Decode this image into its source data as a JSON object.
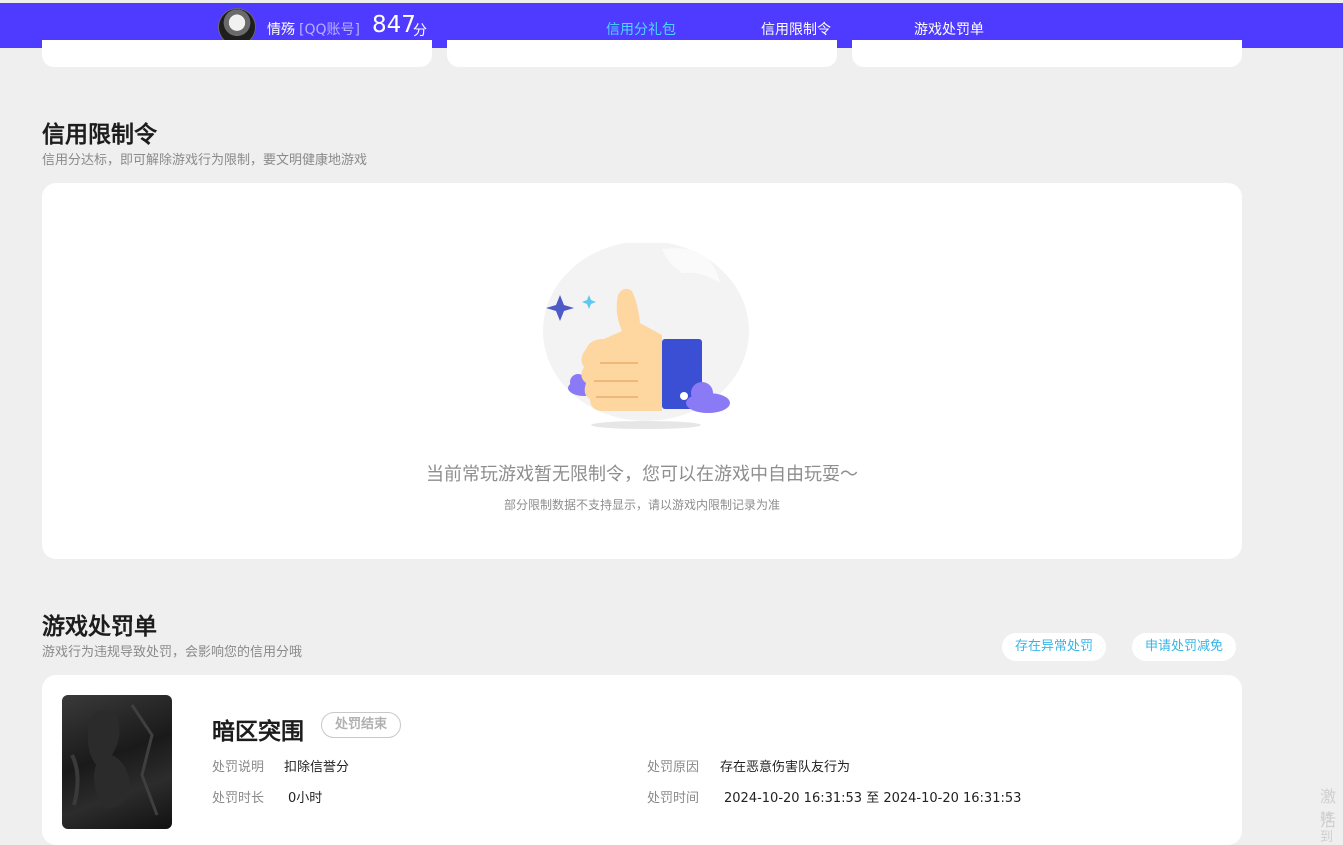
{
  "header": {
    "username": "情殇",
    "account_tag": "[QQ账号]",
    "score": "847",
    "score_unit": "分",
    "tabs": [
      {
        "label": "信用分礼包",
        "active": true
      },
      {
        "label": "信用限制令",
        "active": false
      },
      {
        "label": "游戏处罚单",
        "active": false
      }
    ]
  },
  "restriction": {
    "title": "信用限制令",
    "subtitle": "信用分达标，即可解除游戏行为限制，要文明健康地游戏",
    "empty_message": "当前常玩游戏暂无限制令，您可以在游戏中自由玩耍～",
    "empty_note": "部分限制数据不支持显示，请以游戏内限制记录为准"
  },
  "penalty": {
    "title": "游戏处罚单",
    "subtitle": "游戏行为违规导致处罚，会影响您的信用分哦",
    "btn_abnormal": "存在异常处罚",
    "btn_appeal": "申请处罚减免",
    "item": {
      "game_name": "暗区突围",
      "status": "处罚结束",
      "desc_label": "处罚说明",
      "desc_value": "扣除信誉分",
      "reason_label": "处罚原因",
      "reason_value": "存在恶意伤害队友行为",
      "duration_label": "处罚时长",
      "duration_value": "0小时",
      "time_label": "处罚时间",
      "time_value": "2024-10-20 16:31:53 至 2024-10-20 16:31:53"
    }
  },
  "side": {
    "line1": "激活",
    "line2": "转到"
  },
  "colors": {
    "topbar": "#4f3bff",
    "active_tab": "#4fd6ff",
    "link": "#35b6e8"
  }
}
